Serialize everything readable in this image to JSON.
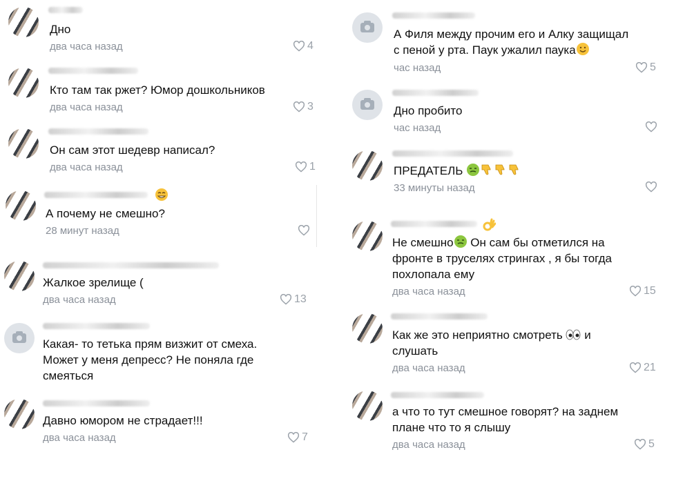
{
  "left": [
    {
      "text": "Дно",
      "time": "два часа назад",
      "likes": "4"
    },
    {
      "text": "Кто там так ржет? Юмор дошкольников",
      "time": "два часа назад",
      "likes": "3"
    },
    {
      "text": "Он сам этот шедевр написал?",
      "time": "два часа назад",
      "likes": "1"
    },
    {
      "text": "А почему не смешно?",
      "time": "28 минут назад",
      "likes": ""
    },
    {
      "text": "Жалкое зрелище (",
      "time": "два часа назад",
      "likes": "13"
    },
    {
      "text": "Какая- то тетька прям визжит от смеха.\nМожет у меня депресс? Не поняла где\nсмеяться",
      "time": "",
      "likes": ""
    },
    {
      "text": "Давно юмором не страдает!!!",
      "time": "два часа назад",
      "likes": "7"
    }
  ],
  "right": [
    {
      "text": "А Филя между прочим его и Алку защищал\nс пеной у рта. Паук ужалил паука",
      "time": "час назад",
      "likes": "5"
    },
    {
      "text": "Дно пробито",
      "time": "час назад",
      "likes": ""
    },
    {
      "text": "ПРЕДАТЕЛЬ",
      "time": "33 минуты назад",
      "likes": ""
    },
    {
      "text": "Не смешно",
      "text2": "  Он сам  бы отметился на\nфронте в труселях  стрингах , я бы тогда\nпохлопала ему",
      "time": "два часа назад",
      "likes": "15"
    },
    {
      "text": "Как же это неприятно смотреть",
      "text2": " и\nслушать",
      "time": "два часа назад",
      "likes": "21"
    },
    {
      "text": "а что то тут смешное говорят? на заднем\nплане что то я слышу",
      "time": "два часа назад",
      "likes": "5"
    }
  ],
  "icons": {
    "heart": "heart-icon",
    "camera": "camera-placeholder-icon",
    "emojis": [
      "smiling-face-emoji",
      "nauseated-face-emoji",
      "thumbs-down-emoji",
      "ok-hand-emoji",
      "eyes-emoji",
      "sweat-smile-emoji"
    ]
  }
}
